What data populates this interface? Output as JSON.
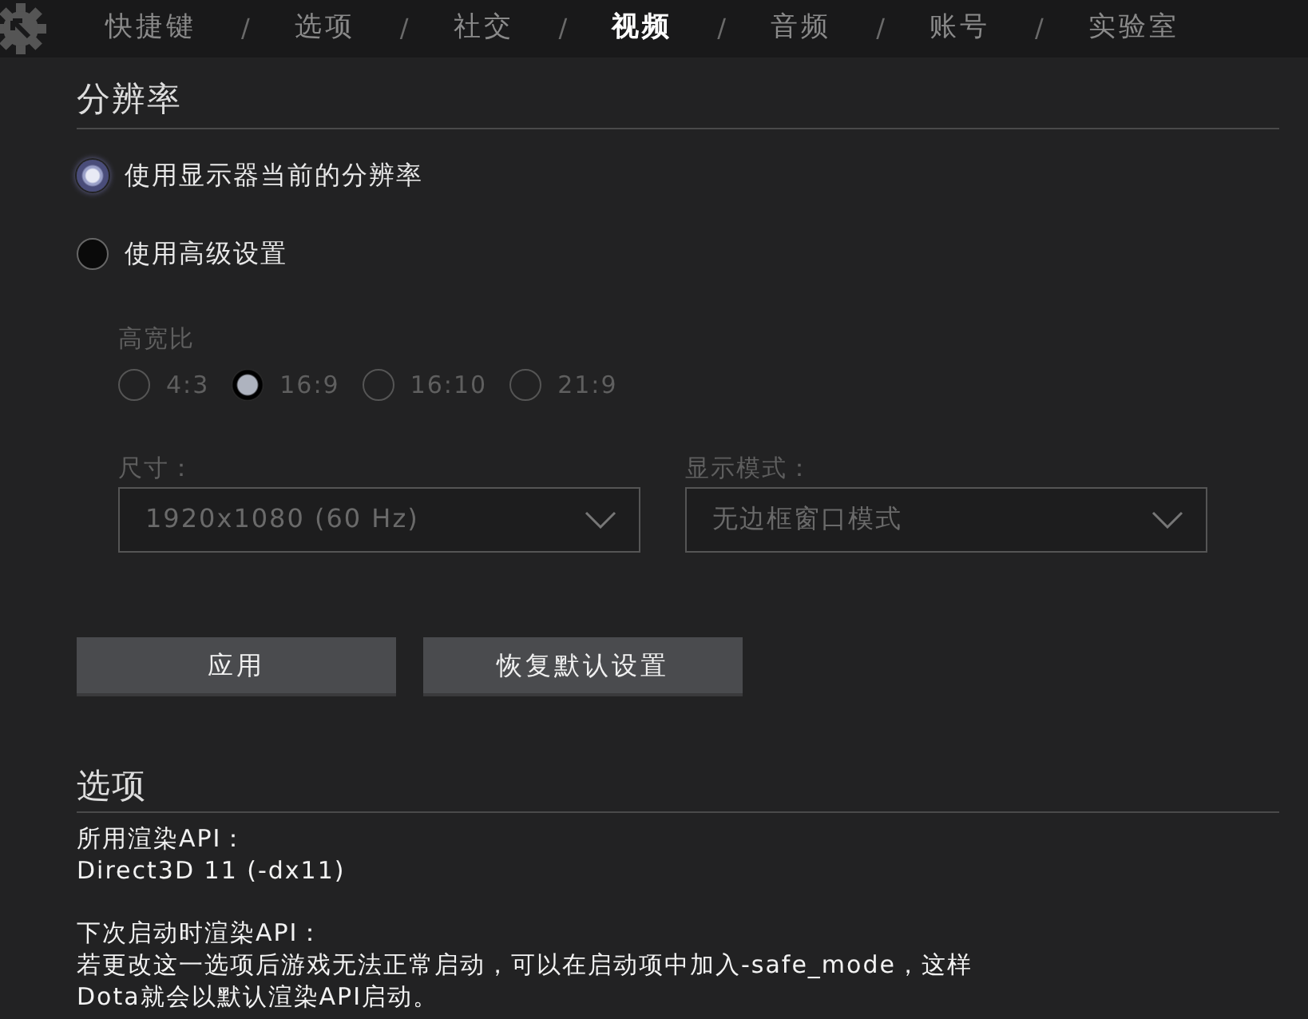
{
  "tabs": [
    {
      "label": "快捷键",
      "selected": false
    },
    {
      "label": "选项",
      "selected": false
    },
    {
      "label": "社交",
      "selected": false
    },
    {
      "label": "视频",
      "selected": true
    },
    {
      "label": "音频",
      "selected": false
    },
    {
      "label": "账号",
      "selected": false
    },
    {
      "label": "实验室",
      "selected": false
    }
  ],
  "tab_separator": "/",
  "resolution": {
    "title": "分辨率",
    "modes": [
      {
        "label": "使用显示器当前的分辨率",
        "selected": true
      },
      {
        "label": "使用高级设置",
        "selected": false
      }
    ],
    "aspect_ratio": {
      "label": "高宽比",
      "disabled": true,
      "options": [
        {
          "label": "4:3",
          "selected": false
        },
        {
          "label": "16:9",
          "selected": true
        },
        {
          "label": "16:10",
          "selected": false
        },
        {
          "label": "21:9",
          "selected": false
        }
      ]
    },
    "dropdowns": [
      {
        "label": "尺寸：",
        "value": "1920x1080 (60 Hz)",
        "disabled": true
      },
      {
        "label": "显示模式：",
        "value": "无边框窗口模式",
        "disabled": true
      }
    ],
    "buttons": [
      "应用",
      "恢复默认设置"
    ]
  },
  "options": {
    "title": "选项",
    "items": [
      {
        "label": "所用渲染API：",
        "value": "Direct3D 11 (-dx11)"
      },
      {
        "label": "下次启动时渲染API：",
        "value": "若更改这一选项后游戏无法正常启动，可以在启动项中加入-safe_mode，这样Dota就会以默认渲染API启动。"
      }
    ]
  }
}
